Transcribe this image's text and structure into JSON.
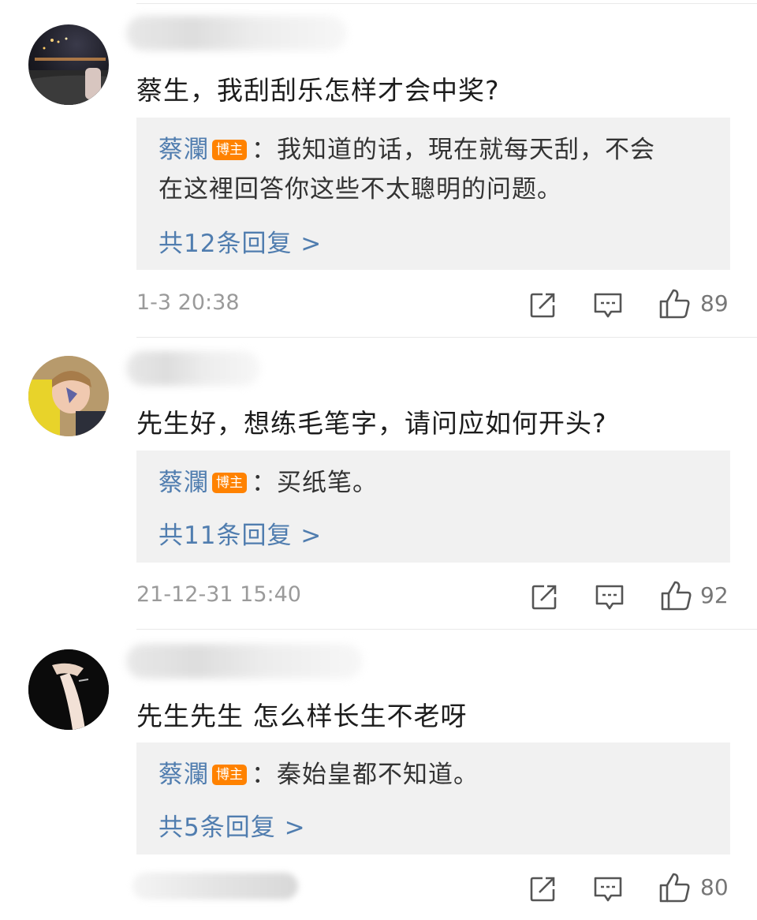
{
  "comments": [
    {
      "body": "蔡生，我刮刮乐怎样才会中奖?",
      "reply": {
        "author": "蔡瀾",
        "badge": "博主",
        "text": "：我知道的话，現在就每天刮，不会在这裡回答你这些不太聰明的问题。",
        "text_line1": "：我知道的话，現在就每天刮，不会",
        "text_line2": "在这裡回答你这些不太聰明的问题。"
      },
      "more_replies": "共12条回复 >",
      "time": "1-3 20:38",
      "likes": "89"
    },
    {
      "body": "先生好，想练毛笔字，请问应如何开头?",
      "reply": {
        "author": "蔡瀾",
        "badge": "博主",
        "text": "：买纸笔。"
      },
      "more_replies": "共11条回复 >",
      "time": "21-12-31 15:40",
      "likes": "92"
    },
    {
      "body": "先生先生 怎么样长生不老呀",
      "reply": {
        "author": "蔡瀾",
        "badge": "博主",
        "text": "：秦始皇都不知道。"
      },
      "more_replies": "共5条回复 >",
      "time": "",
      "likes": "80"
    }
  ],
  "colors": {
    "author_blue": "#507daf",
    "badge_orange": "#ff8200",
    "reply_bg": "#f1f1f1",
    "meta_gray": "#9a9a9a"
  },
  "icons": [
    "repost-icon",
    "comment-icon",
    "like-icon"
  ]
}
